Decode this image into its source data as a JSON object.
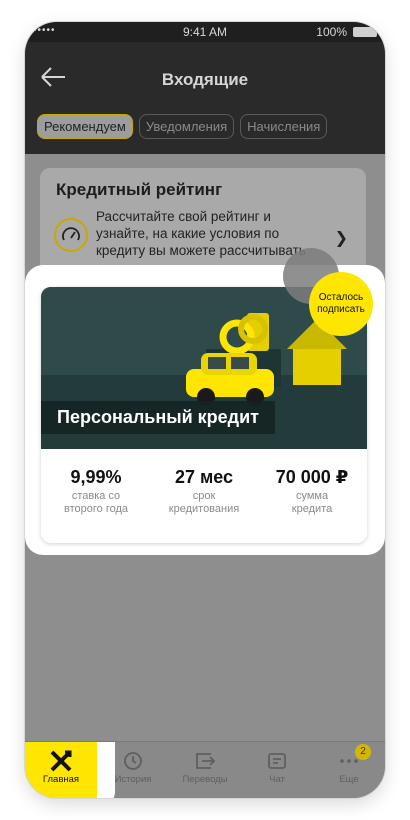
{
  "status_bar": {
    "signal": "•••••",
    "time": "9:41 AM",
    "battery": "100%"
  },
  "header": {
    "title": "Входящие"
  },
  "tabs": [
    {
      "label": "Рекомендуем",
      "active": true
    },
    {
      "label": "Уведомления",
      "active": false
    },
    {
      "label": "Начисления",
      "active": false
    }
  ],
  "credit_rating": {
    "title": "Кредитный рейтинг",
    "line1": "Рассчитайте свой рейтинг и",
    "line2": "узнайте, на какие условия по",
    "line3": "кредиту вы можете рассчитывать",
    "icon": "gauge-icon"
  },
  "promo": {
    "title": "Персональный кредит",
    "badge_line1": "Осталось",
    "badge_line2": "подписать",
    "stats": [
      {
        "value": "9,99%",
        "label1": "ставка со",
        "label2": "второго года"
      },
      {
        "value": "27 мес",
        "label1": "срок",
        "label2": "кредитования"
      },
      {
        "value": "70 000 ₽",
        "label1": "сумма",
        "label2": "кредита"
      }
    ]
  },
  "tabbar": {
    "items": [
      {
        "label": "Главная",
        "icon": "raiffeisen-logo-icon",
        "active": true
      },
      {
        "label": "История",
        "icon": "clock-icon",
        "active": false
      },
      {
        "label": "Переводы",
        "icon": "transfer-icon",
        "active": false
      },
      {
        "label": "Чат",
        "icon": "chat-icon",
        "active": false
      },
      {
        "label": "Еще",
        "icon": "more-icon",
        "active": false,
        "badge": "2"
      }
    ]
  },
  "colors": {
    "accent": "#ffe600",
    "dark": "#2a2a2a",
    "promo_bg": "#2e4b4a"
  }
}
